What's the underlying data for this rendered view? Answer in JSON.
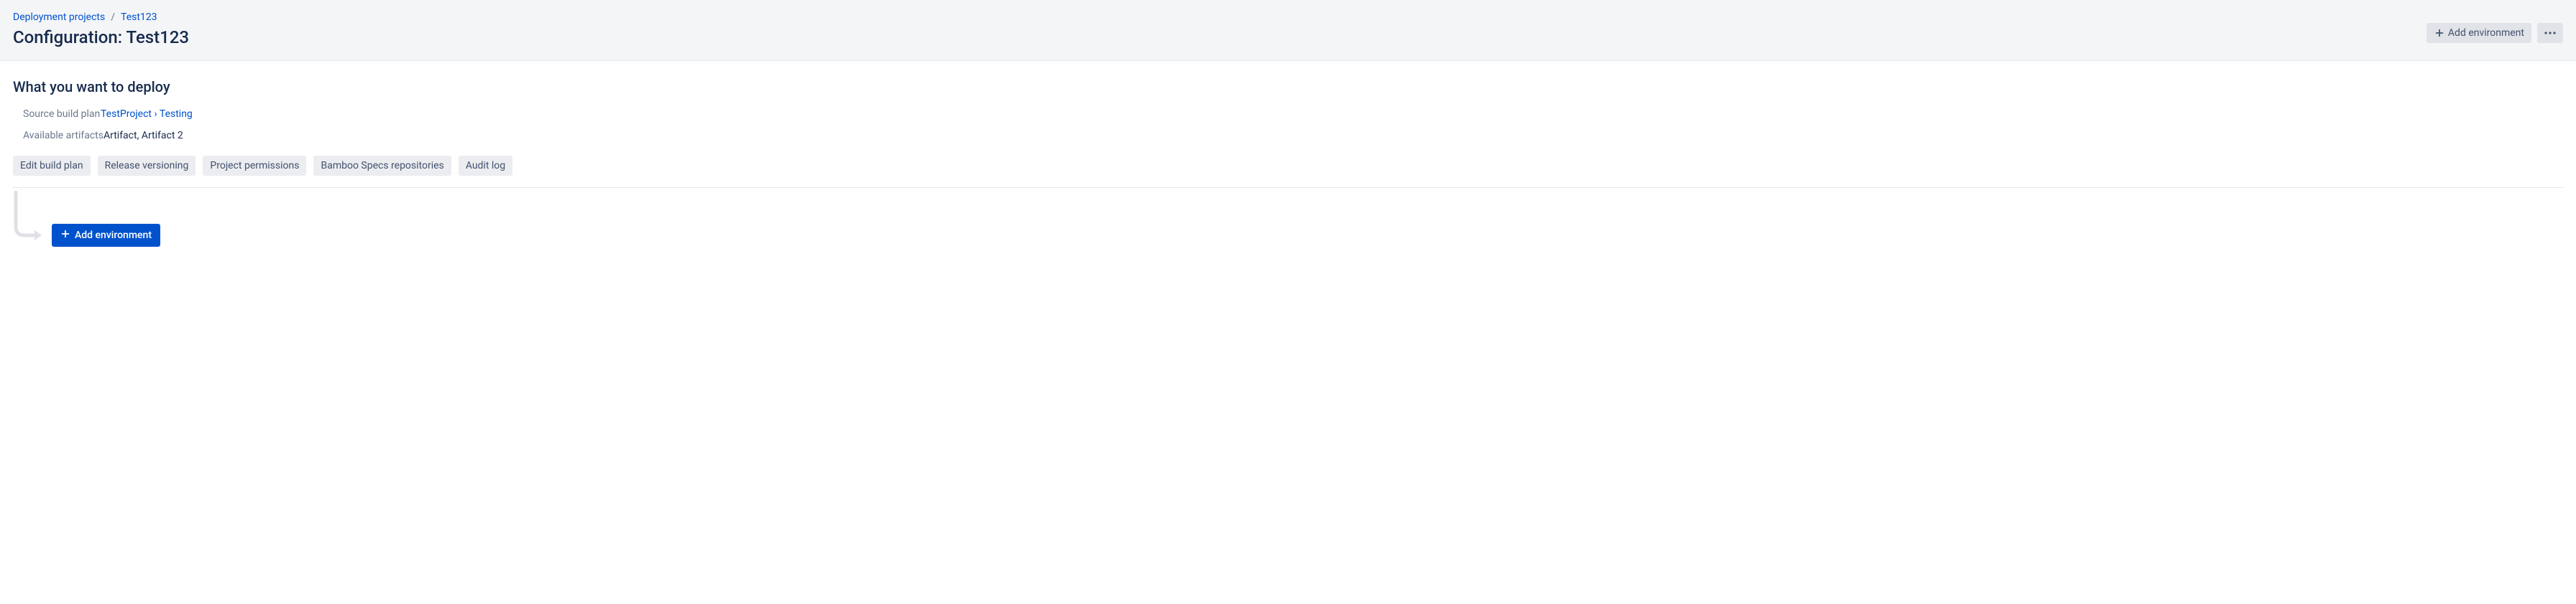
{
  "breadcrumb": {
    "root": "Deployment projects",
    "current": "Test123"
  },
  "page_title": "Configuration: Test123",
  "header_actions": {
    "add_environment": "Add environment"
  },
  "section": {
    "title": "What you want to deploy",
    "source_plan_label": "Source build plan",
    "source_plan_value": "TestProject › Testing",
    "artifacts_label": "Available artifacts",
    "artifacts_value": "Artifact, Artifact 2"
  },
  "action_buttons": {
    "edit_build_plan": "Edit build plan",
    "release_versioning": "Release versioning",
    "project_permissions": "Project permissions",
    "bamboo_specs": "Bamboo Specs repositories",
    "audit_log": "Audit log"
  },
  "add_environment_button": "Add environment"
}
